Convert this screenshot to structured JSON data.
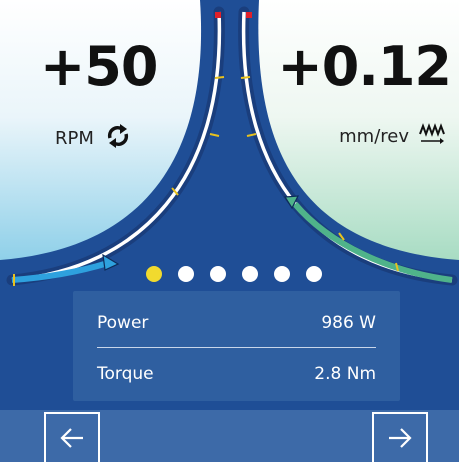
{
  "spindle": {
    "value": "+50",
    "unit": "RPM",
    "icon": "rotate-icon"
  },
  "feed": {
    "value": "+0.12",
    "unit": "mm/rev",
    "icon": "feed-zigzag-arrow-icon"
  },
  "pager": {
    "count": 6,
    "active_index": 0
  },
  "info": {
    "power": {
      "label": "Power",
      "value": "986 W"
    },
    "torque": {
      "label": "Torque",
      "value": "2.8 Nm"
    }
  },
  "nav": {
    "prev_icon": "arrow-left-icon",
    "next_icon": "arrow-right-icon"
  },
  "colors": {
    "background": "#1f4e96",
    "left_gauge": "#2ea1de",
    "right_gauge": "#4fb38a",
    "active_dot": "#f1da2e",
    "panel": "#2f5fa0",
    "bottom_bar": "#3d6aa8"
  }
}
